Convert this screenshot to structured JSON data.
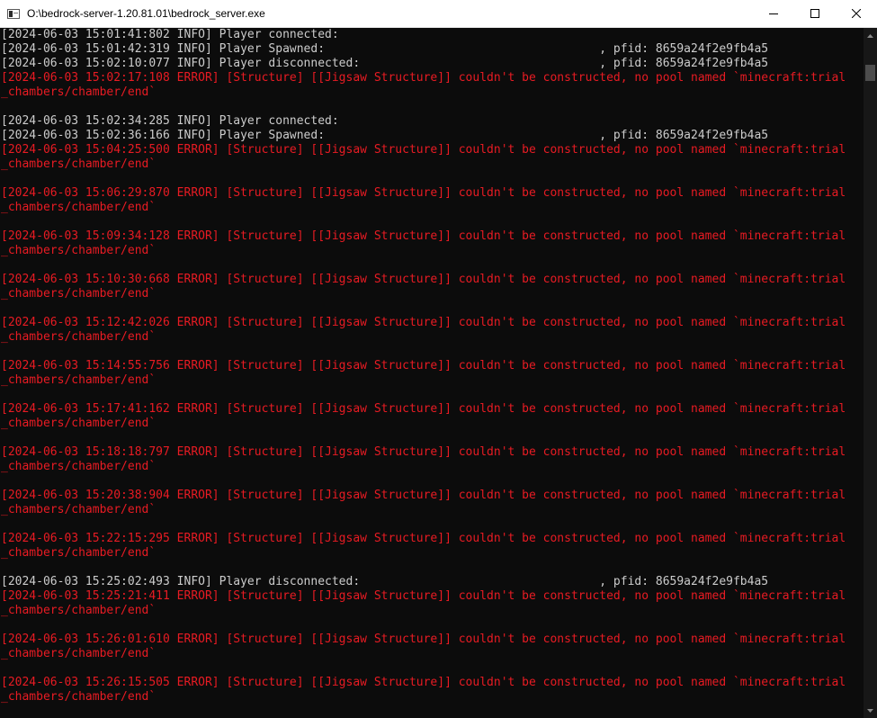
{
  "window": {
    "title": "O:\\bedrock-server-1.20.81.01\\bedrock_server.exe",
    "icon": "console-app-icon",
    "controls": [
      "minimize-icon",
      "maximize-icon",
      "close-icon"
    ]
  },
  "colors": {
    "info": "#cccccc",
    "error": "#e81b23",
    "background": "#0c0c0c"
  },
  "log": [
    {
      "type": "info",
      "text": "[2024-06-03 15:01:41:802 INFO] Player connected:"
    },
    {
      "type": "info",
      "text": "[2024-06-03 15:01:42:319 INFO] Player Spawned:                                       , pfid: 8659a24f2e9fb4a5"
    },
    {
      "type": "info",
      "text": "[2024-06-03 15:02:10:077 INFO] Player disconnected:                                  , pfid: 8659a24f2e9fb4a5"
    },
    {
      "type": "error",
      "text": "[2024-06-03 15:02:17:108 ERROR] [Structure] [[Jigsaw Structure]] couldn't be constructed, no pool named `minecraft:trial"
    },
    {
      "type": "error",
      "text": "_chambers/chamber/end`"
    },
    {
      "type": "blank",
      "text": ""
    },
    {
      "type": "info",
      "text": "[2024-06-03 15:02:34:285 INFO] Player connected:"
    },
    {
      "type": "info",
      "text": "[2024-06-03 15:02:36:166 INFO] Player Spawned:                                       , pfid: 8659a24f2e9fb4a5"
    },
    {
      "type": "error",
      "text": "[2024-06-03 15:04:25:500 ERROR] [Structure] [[Jigsaw Structure]] couldn't be constructed, no pool named `minecraft:trial"
    },
    {
      "type": "error",
      "text": "_chambers/chamber/end`"
    },
    {
      "type": "blank",
      "text": ""
    },
    {
      "type": "error",
      "text": "[2024-06-03 15:06:29:870 ERROR] [Structure] [[Jigsaw Structure]] couldn't be constructed, no pool named `minecraft:trial"
    },
    {
      "type": "error",
      "text": "_chambers/chamber/end`"
    },
    {
      "type": "blank",
      "text": ""
    },
    {
      "type": "error",
      "text": "[2024-06-03 15:09:34:128 ERROR] [Structure] [[Jigsaw Structure]] couldn't be constructed, no pool named `minecraft:trial"
    },
    {
      "type": "error",
      "text": "_chambers/chamber/end`"
    },
    {
      "type": "blank",
      "text": ""
    },
    {
      "type": "error",
      "text": "[2024-06-03 15:10:30:668 ERROR] [Structure] [[Jigsaw Structure]] couldn't be constructed, no pool named `minecraft:trial"
    },
    {
      "type": "error",
      "text": "_chambers/chamber/end`"
    },
    {
      "type": "blank",
      "text": ""
    },
    {
      "type": "error",
      "text": "[2024-06-03 15:12:42:026 ERROR] [Structure] [[Jigsaw Structure]] couldn't be constructed, no pool named `minecraft:trial"
    },
    {
      "type": "error",
      "text": "_chambers/chamber/end`"
    },
    {
      "type": "blank",
      "text": ""
    },
    {
      "type": "error",
      "text": "[2024-06-03 15:14:55:756 ERROR] [Structure] [[Jigsaw Structure]] couldn't be constructed, no pool named `minecraft:trial"
    },
    {
      "type": "error",
      "text": "_chambers/chamber/end`"
    },
    {
      "type": "blank",
      "text": ""
    },
    {
      "type": "error",
      "text": "[2024-06-03 15:17:41:162 ERROR] [Structure] [[Jigsaw Structure]] couldn't be constructed, no pool named `minecraft:trial"
    },
    {
      "type": "error",
      "text": "_chambers/chamber/end`"
    },
    {
      "type": "blank",
      "text": ""
    },
    {
      "type": "error",
      "text": "[2024-06-03 15:18:18:797 ERROR] [Structure] [[Jigsaw Structure]] couldn't be constructed, no pool named `minecraft:trial"
    },
    {
      "type": "error",
      "text": "_chambers/chamber/end`"
    },
    {
      "type": "blank",
      "text": ""
    },
    {
      "type": "error",
      "text": "[2024-06-03 15:20:38:904 ERROR] [Structure] [[Jigsaw Structure]] couldn't be constructed, no pool named `minecraft:trial"
    },
    {
      "type": "error",
      "text": "_chambers/chamber/end`"
    },
    {
      "type": "blank",
      "text": ""
    },
    {
      "type": "error",
      "text": "[2024-06-03 15:22:15:295 ERROR] [Structure] [[Jigsaw Structure]] couldn't be constructed, no pool named `minecraft:trial"
    },
    {
      "type": "error",
      "text": "_chambers/chamber/end`"
    },
    {
      "type": "blank",
      "text": ""
    },
    {
      "type": "info",
      "text": "[2024-06-03 15:25:02:493 INFO] Player disconnected:                                  , pfid: 8659a24f2e9fb4a5"
    },
    {
      "type": "error",
      "text": "[2024-06-03 15:25:21:411 ERROR] [Structure] [[Jigsaw Structure]] couldn't be constructed, no pool named `minecraft:trial"
    },
    {
      "type": "error",
      "text": "_chambers/chamber/end`"
    },
    {
      "type": "blank",
      "text": ""
    },
    {
      "type": "error",
      "text": "[2024-06-03 15:26:01:610 ERROR] [Structure] [[Jigsaw Structure]] couldn't be constructed, no pool named `minecraft:trial"
    },
    {
      "type": "error",
      "text": "_chambers/chamber/end`"
    },
    {
      "type": "blank",
      "text": ""
    },
    {
      "type": "error",
      "text": "[2024-06-03 15:26:15:505 ERROR] [Structure] [[Jigsaw Structure]] couldn't be constructed, no pool named `minecraft:trial"
    },
    {
      "type": "error",
      "text": "_chambers/chamber/end`"
    }
  ]
}
